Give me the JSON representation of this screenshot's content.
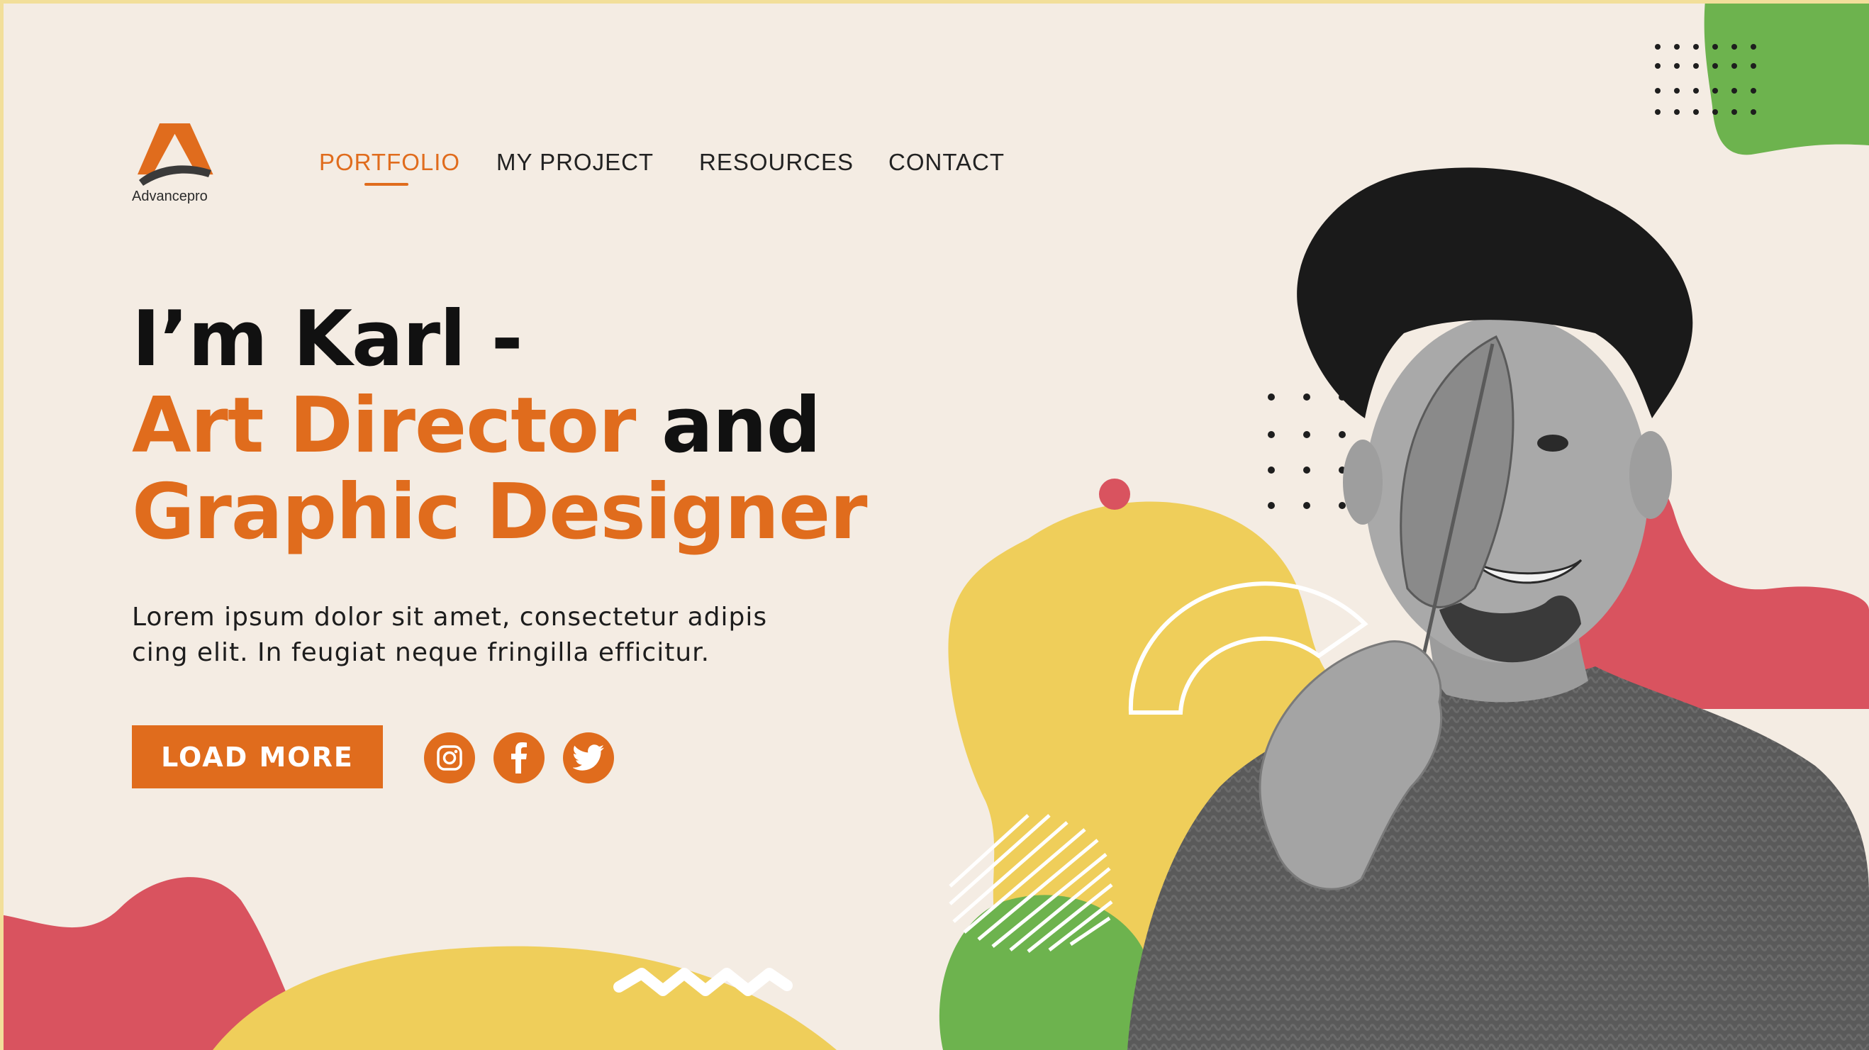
{
  "brand": {
    "name": "Advancepro"
  },
  "nav": {
    "items": [
      {
        "label": "PORTFOLIO",
        "active": true
      },
      {
        "label": "MY PROJECT",
        "active": false
      },
      {
        "label": "RESOURCES",
        "active": false
      },
      {
        "label": "CONTACT",
        "active": false
      }
    ]
  },
  "hero": {
    "line1": "I’m Karl -",
    "line2_highlight": "Art Director",
    "line2_rest": " and",
    "line3": "Graphic Designer",
    "paragraph_line1": "Lorem ipsum dolor sit amet, consectetur adipis",
    "paragraph_line2": "cing elit. In feugiat neque fringilla efficitur.",
    "cta_label": "LOAD MORE"
  },
  "social": [
    "instagram-icon",
    "facebook-icon",
    "twitter-icon"
  ],
  "colors": {
    "accent": "#e06c1d",
    "background": "#f4ece3",
    "yellow": "#efce5a",
    "red": "#d9535f",
    "green": "#6db34e"
  }
}
